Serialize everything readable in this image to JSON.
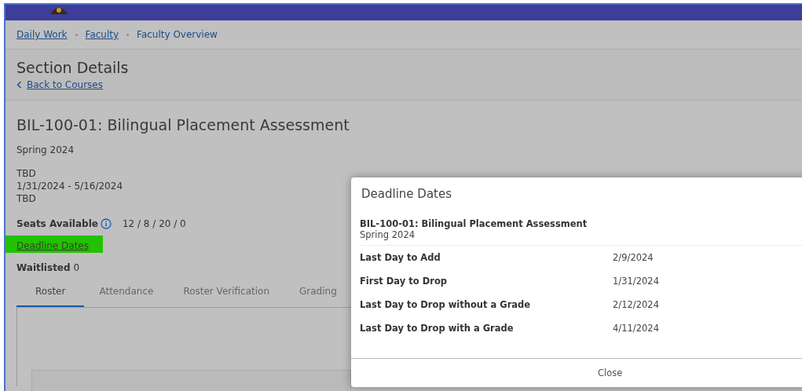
{
  "breadcrumbs": [
    {
      "label": "Daily Work",
      "link": true
    },
    {
      "label": "Faculty",
      "link": true
    },
    {
      "label": "Faculty Overview",
      "link": false
    }
  ],
  "page_title": "Section Details",
  "back_link": "Back to Courses",
  "section": {
    "title": "BIL-100-01: Bilingual Placement Assessment",
    "term": "Spring 2024",
    "meeting_lines": [
      "TBD",
      "1/31/2024 - 5/16/2024",
      "TBD"
    ],
    "seats_label": "Seats Available",
    "seats_value": "12 / 8 / 20 / 0",
    "deadline_link": "Deadline Dates",
    "deadline_highlighted": true,
    "waitlisted_label": "Waitlisted",
    "waitlisted_value": "0"
  },
  "tabs": [
    {
      "label": "Roster",
      "selected": true
    },
    {
      "label": "Attendance",
      "selected": false
    },
    {
      "label": "Roster Verification",
      "selected": false
    },
    {
      "label": "Grading",
      "selected": false
    }
  ],
  "dialog": {
    "title": "Deadline Dates",
    "course": "BIL-100-01: Bilingual Placement Assessment",
    "term": "Spring 2024",
    "rows": [
      {
        "label": "Last Day to Add",
        "date": "2/9/2024"
      },
      {
        "label": "First Day to Drop",
        "date": "1/31/2024"
      },
      {
        "label": "Last Day to Drop without a Grade",
        "date": "2/12/2024"
      },
      {
        "label": "Last Day to Drop with a Grade",
        "date": "4/11/2024"
      }
    ],
    "close_button": "Close"
  }
}
